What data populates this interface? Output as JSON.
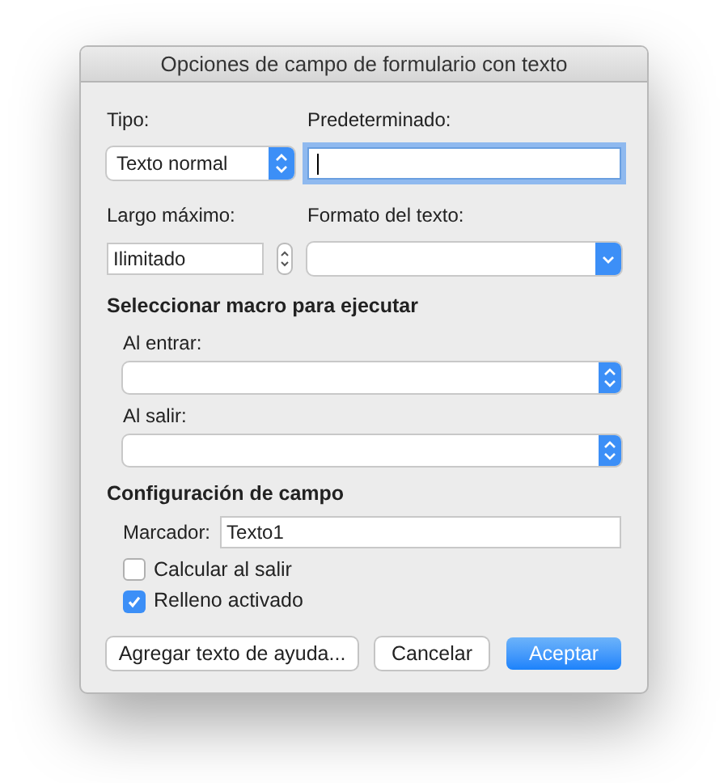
{
  "window": {
    "title": "Opciones de campo de formulario con texto"
  },
  "type": {
    "label": "Tipo:",
    "value": "Texto normal"
  },
  "default": {
    "label": "Predeterminado:",
    "focused": true
  },
  "max_length": {
    "label": "Largo máximo:",
    "value": "Ilimitado"
  },
  "text_format": {
    "label": "Formato del texto:"
  },
  "macro_section": {
    "title": "Seleccionar macro para ejecutar",
    "entry": {
      "label": "Al entrar:"
    },
    "exit": {
      "label": "Al salir:"
    }
  },
  "field_settings": {
    "title": "Configuración de campo",
    "bookmark": {
      "label": "Marcador:",
      "value": "Texto1"
    },
    "options": [
      {
        "label": "Calcular al salir",
        "checked": false
      },
      {
        "label": "Relleno activado",
        "checked": true
      }
    ]
  },
  "buttons": [
    {
      "label": "Agregar texto de ayuda...",
      "kind": "plain"
    },
    {
      "label": "Cancelar",
      "kind": "plain"
    },
    {
      "label": "Aceptar",
      "kind": "default"
    }
  ]
}
